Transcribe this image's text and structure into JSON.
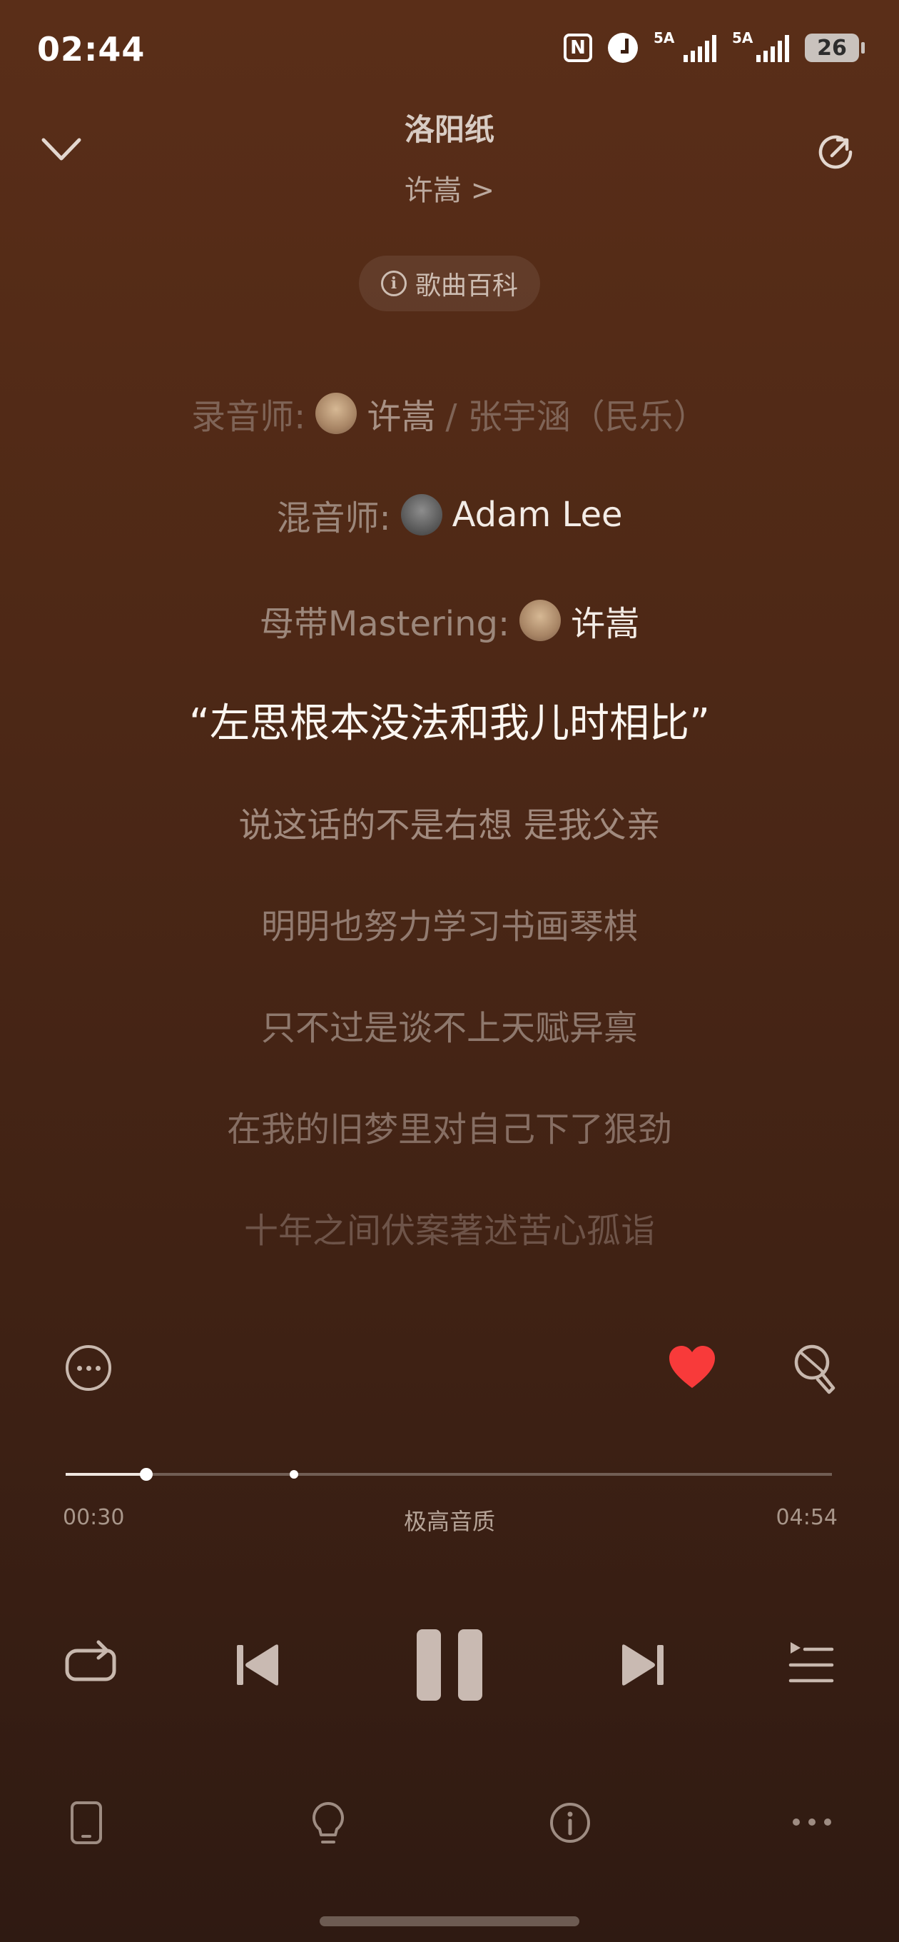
{
  "status_bar": {
    "time": "02:44",
    "nfc_label": "N",
    "signal1_label": "5A",
    "signal2_label": "5A",
    "battery": "26"
  },
  "header": {
    "title": "洛阳纸",
    "artist": "许嵩 >",
    "wiki_chip": "歌曲百科"
  },
  "lyrics": {
    "credit_recording_label": "录音师:",
    "credit_recording_name": "许嵩",
    "credit_recording_extra": "/ 张宇涵（民乐）",
    "credit_mixing_label": "混音师:",
    "credit_mixing_name": "Adam Lee",
    "credit_mastering_label": "母带Mastering:",
    "credit_mastering_name": "许嵩",
    "current": "“左思根本没法和我儿时相比”",
    "l5": "说这话的不是右想 是我父亲",
    "l6": "明明也努力学习书画琴棋",
    "l7": "只不过是谈不上天赋异禀",
    "l8": "在我的旧梦里对自己下了狠劲",
    "l9": "十年之间伏案著述苦心孤诣"
  },
  "player": {
    "time_current": "00:30",
    "time_total": "04:54",
    "quality": "极高音质",
    "progress": 0.1
  },
  "colors": {
    "heart": "#f83a3a",
    "background_top": "#5a2e18",
    "background_bottom": "#2f1a12"
  },
  "icons": {
    "collapse": "chevron-down-icon",
    "share": "share-icon",
    "more_circle": "more-circle-icon",
    "like": "heart-icon",
    "sing": "microphone-icon",
    "repeat": "repeat-icon",
    "prev": "skip-previous-icon",
    "pause": "pause-icon",
    "next": "skip-next-icon",
    "playlist": "playlist-icon",
    "device": "phone-device-icon",
    "tips": "lightbulb-icon",
    "info": "info-icon",
    "more": "more-horizontal-icon"
  }
}
